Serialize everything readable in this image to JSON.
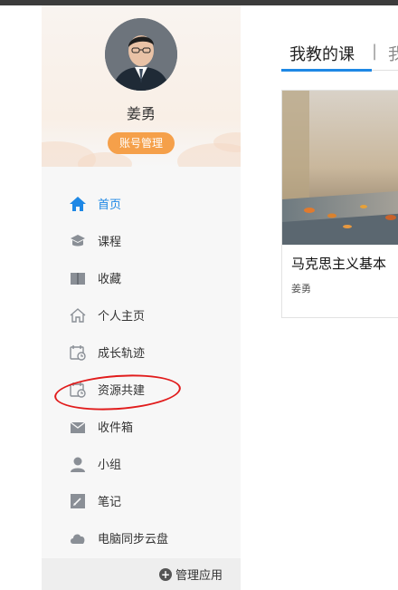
{
  "profile": {
    "name": "姜勇",
    "account_button": "账号管理"
  },
  "menu": [
    {
      "label": "首页",
      "icon": "home-icon",
      "active": true
    },
    {
      "label": "课程",
      "icon": "course-icon",
      "active": false
    },
    {
      "label": "收藏",
      "icon": "book-icon",
      "active": false
    },
    {
      "label": "个人主页",
      "icon": "house-outline-icon",
      "active": false
    },
    {
      "label": "成长轨迹",
      "icon": "calendar-clock-icon",
      "active": false
    },
    {
      "label": "资源共建",
      "icon": "calendar-clock-icon",
      "active": false
    },
    {
      "label": "收件箱",
      "icon": "inbox-icon",
      "active": false
    },
    {
      "label": "小组",
      "icon": "user-icon",
      "active": false
    },
    {
      "label": "笔记",
      "icon": "note-icon",
      "active": false
    },
    {
      "label": "电脑同步云盘",
      "icon": "cloud-icon",
      "active": false
    }
  ],
  "manage": {
    "label": "管理应用",
    "icon": "plus-circle-icon"
  },
  "tabs": {
    "my_teaching": "我教的课",
    "separator": "|",
    "second_visible": "我"
  },
  "course_card": {
    "title": "马克思主义基本",
    "author": "姜勇"
  },
  "colors": {
    "accent": "#1e88e5",
    "account_button": "#f5a04a",
    "annotation": "#e11c1c"
  }
}
